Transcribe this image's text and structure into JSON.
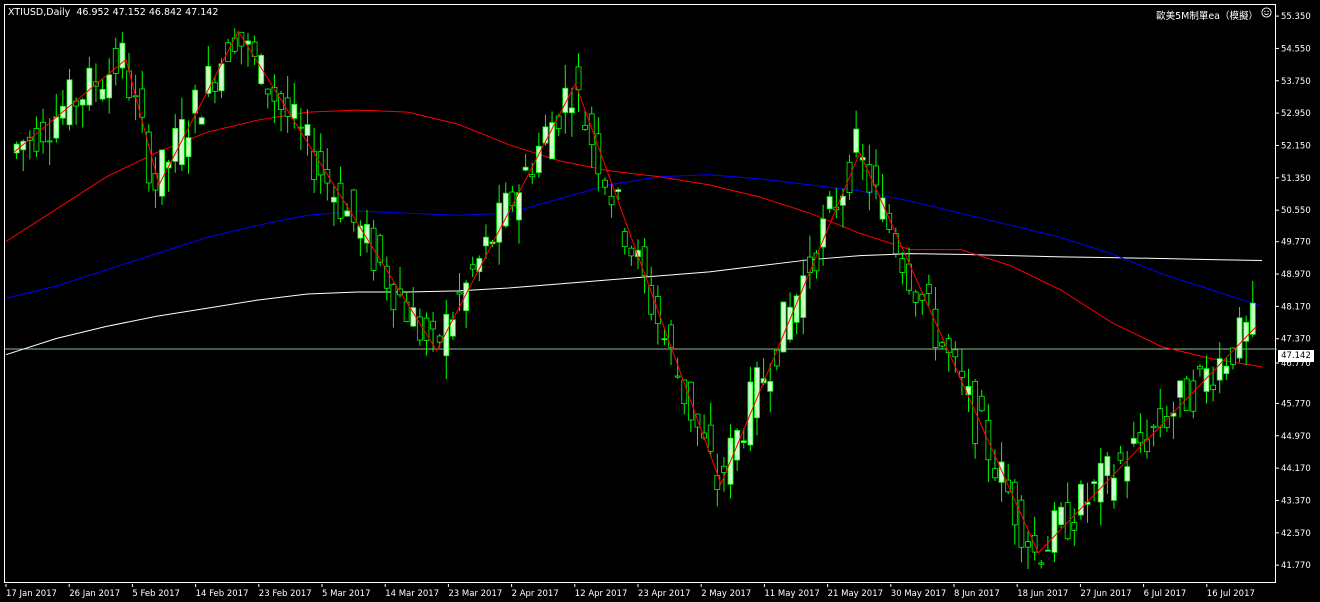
{
  "header": {
    "symbol_line": "XTIUSD,Daily  46.952 47.152 46.842 47.142",
    "ea_name": "歐美5M制單ea（模擬）",
    "smiley_icon": "smiley-face-icon"
  },
  "current_price": "47.142",
  "price_axis": [
    "55.350",
    "54.550",
    "53.750",
    "52.950",
    "52.150",
    "51.350",
    "50.550",
    "49.770",
    "48.970",
    "48.170",
    "47.370",
    "46.770",
    "45.770",
    "44.970",
    "44.170",
    "43.370",
    "42.570",
    "41.770"
  ],
  "time_axis": [
    "17 Jan 2017",
    "26 Jan 2017",
    "5 Feb 2017",
    "14 Feb 2017",
    "23 Feb 2017",
    "5 Mar 2017",
    "14 Mar 2017",
    "23 Mar 2017",
    "2 Apr 2017",
    "12 Apr 2017",
    "23 Apr 2017",
    "2 May 2017",
    "11 May 2017",
    "21 May 2017",
    "30 May 2017",
    "8 Jun 2017",
    "18 Jun 2017",
    "27 Jun 2017",
    "6 Jul 2017",
    "16 Jul 2017"
  ],
  "colors": {
    "background": "#000000",
    "bull_candle": "#ccffcc",
    "candle_outline": "#00ff00",
    "zigzag": "#ff0000",
    "ma_fast": "#ff0000",
    "ma_mid": "#0000ff",
    "ma_slow": "#ffffff",
    "current_line": "#8fbc8f"
  },
  "chart_data": {
    "type": "candlestick",
    "symbol": "XTIUSD",
    "timeframe": "Daily",
    "ylim": [
      41.7,
      55.55
    ],
    "zigzag": [
      {
        "x": "2017-01-17",
        "y": 52.0
      },
      {
        "x": "2017-02-03",
        "y": 54.3
      },
      {
        "x": "2017-02-08",
        "y": 51.2
      },
      {
        "x": "2017-02-20",
        "y": 55.0
      },
      {
        "x": "2017-03-22",
        "y": 47.1
      },
      {
        "x": "2017-04-12",
        "y": 53.7
      },
      {
        "x": "2017-05-04",
        "y": 43.8
      },
      {
        "x": "2017-05-25",
        "y": 52.0
      },
      {
        "x": "2017-06-21",
        "y": 42.1
      },
      {
        "x": "2017-07-24",
        "y": 47.7
      }
    ],
    "ma_fast": [
      49.8,
      50.6,
      51.4,
      52.0,
      52.5,
      52.8,
      53.0,
      53.05,
      53.0,
      52.7,
      52.2,
      51.8,
      51.55,
      51.4,
      51.2,
      50.9,
      50.5,
      50.0,
      49.6,
      49.6,
      49.2,
      48.6,
      47.8,
      47.2,
      46.9,
      46.7
    ],
    "ma_mid": [
      48.4,
      48.7,
      49.1,
      49.5,
      49.9,
      50.2,
      50.45,
      50.55,
      50.5,
      50.45,
      50.5,
      50.85,
      51.2,
      51.4,
      51.45,
      51.35,
      51.2,
      51.05,
      50.8,
      50.5,
      50.2,
      49.9,
      49.5,
      49.0,
      48.6,
      48.2
    ],
    "ma_slow": [
      47.0,
      47.4,
      47.7,
      47.95,
      48.15,
      48.35,
      48.5,
      48.55,
      48.55,
      48.58,
      48.65,
      48.75,
      48.85,
      48.95,
      49.05,
      49.2,
      49.35,
      49.45,
      49.5,
      49.48,
      49.45,
      49.42,
      49.4,
      49.38,
      49.35,
      49.33
    ],
    "current": 47.142
  }
}
